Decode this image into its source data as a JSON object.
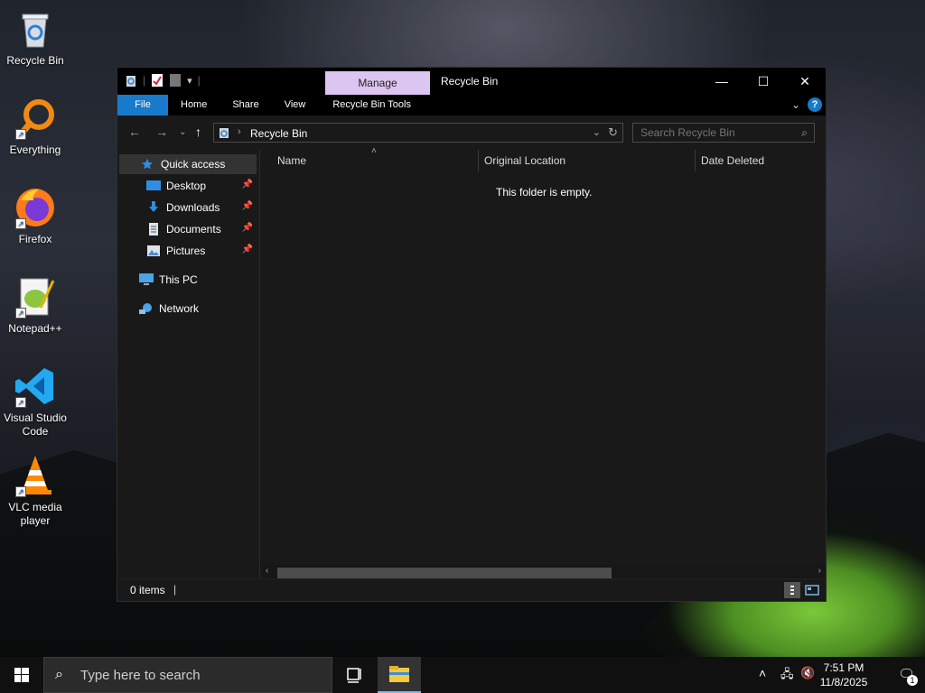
{
  "desktop": {
    "icons": [
      {
        "label": "Recycle Bin",
        "icon": "recycle-bin-icon"
      },
      {
        "label": "Everything",
        "icon": "everything-search-icon"
      },
      {
        "label": "Firefox",
        "icon": "firefox-icon"
      },
      {
        "label": "Notepad++",
        "icon": "notepad-plus-plus-icon"
      },
      {
        "label": "Visual Studio Code",
        "icon": "vscode-icon"
      },
      {
        "label": "VLC media player",
        "icon": "vlc-icon"
      }
    ]
  },
  "window": {
    "title": "Recycle Bin",
    "contextual_tab": "Manage",
    "controls": {
      "minimize": "—",
      "maximize": "☐",
      "close": "✕"
    },
    "ribbon_tabs": [
      "File",
      "Home",
      "Share",
      "View",
      "Recycle Bin Tools"
    ],
    "address": {
      "path": "Recycle Bin"
    },
    "search": {
      "placeholder": "Search Recycle Bin"
    },
    "nav_pane": {
      "quick_access": "Quick access",
      "pinned": [
        "Desktop",
        "Downloads",
        "Documents",
        "Pictures"
      ],
      "this_pc": "This PC",
      "network": "Network"
    },
    "columns": [
      "Name",
      "Original Location",
      "Date Deleted"
    ],
    "empty_message": "This folder is empty.",
    "status": {
      "count": "0 items"
    }
  },
  "taskbar": {
    "search_placeholder": "Type here to search",
    "time": "7:51 PM",
    "date": "11/8/2025",
    "notification_count": "1"
  },
  "colors": {
    "accent": "#1979ca",
    "manage_tab": "#dcc5f0",
    "window_bg": "#191919"
  }
}
